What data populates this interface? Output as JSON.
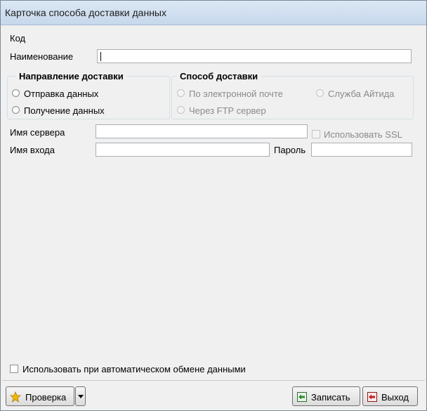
{
  "window": {
    "title": "Карточка способа доставки данных"
  },
  "fields": {
    "code_label": "Код",
    "name_label": "Наименование",
    "name_value": "",
    "server_label": "Имя сервера",
    "server_value": "",
    "login_label": "Имя входа",
    "login_value": "",
    "password_label": "Пароль",
    "password_value": "",
    "ssl_label": "Использовать SSL"
  },
  "direction": {
    "title": "Направление доставки",
    "options": [
      "Отправка данных",
      "Получение данных"
    ]
  },
  "method": {
    "title": "Способ доставки",
    "options": [
      "По электронной почте",
      "Служба Айтида",
      "Через FTP сервер"
    ]
  },
  "auto_exchange_label": "Использовать при автоматическом обмене данными",
  "buttons": {
    "check": "Проверка",
    "save": "Записать",
    "exit": "Выход"
  },
  "icons": {
    "check": "star-icon",
    "dropdown": "triangle-down-icon",
    "save": "save-arrow-icon",
    "exit": "exit-icon"
  }
}
